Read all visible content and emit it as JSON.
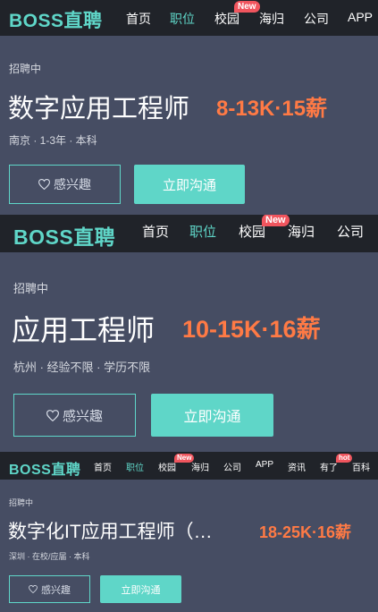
{
  "panels": [
    {
      "logo": "BOSS直聘",
      "nav": [
        "首页",
        "职位",
        "校园",
        "海归",
        "公司",
        "APP"
      ],
      "active_nav": "职位",
      "badge_new": "New",
      "status": "招聘中",
      "title": "数字应用工程师",
      "salary": "8-13K·15薪",
      "meta": "南京 · 1-3年 · 本科",
      "interest_label": "感兴趣",
      "chat_label": "立即沟通"
    },
    {
      "logo": "BOSS直聘",
      "nav": [
        "首页",
        "职位",
        "校园",
        "海归",
        "公司"
      ],
      "active_nav": "职位",
      "badge_new": "New",
      "status": "招聘中",
      "title": "应用工程师",
      "salary": "10-15K·16薪",
      "meta": "杭州 · 经验不限 · 学历不限",
      "interest_label": "感兴趣",
      "chat_label": "立即沟通"
    },
    {
      "logo": "BOSS直聘",
      "nav": [
        "首页",
        "职位",
        "校园",
        "海归",
        "公司",
        "APP",
        "资讯",
        "有了",
        "百科"
      ],
      "active_nav": "职位",
      "badge_new": "New",
      "badge_hot": "hot",
      "status": "招聘中",
      "title": "数字化IT应用工程师（…",
      "salary": "18-25K·16薪",
      "meta": "深圳 · 在校/应届 · 本科",
      "interest_label": "感兴趣",
      "chat_label": "立即沟通"
    }
  ],
  "colors": {
    "accent": "#5fd6c8",
    "salary": "#ff7a45",
    "nav_bg": "#202329",
    "panel_bg": "#464d63",
    "badge": "#f0555e"
  }
}
